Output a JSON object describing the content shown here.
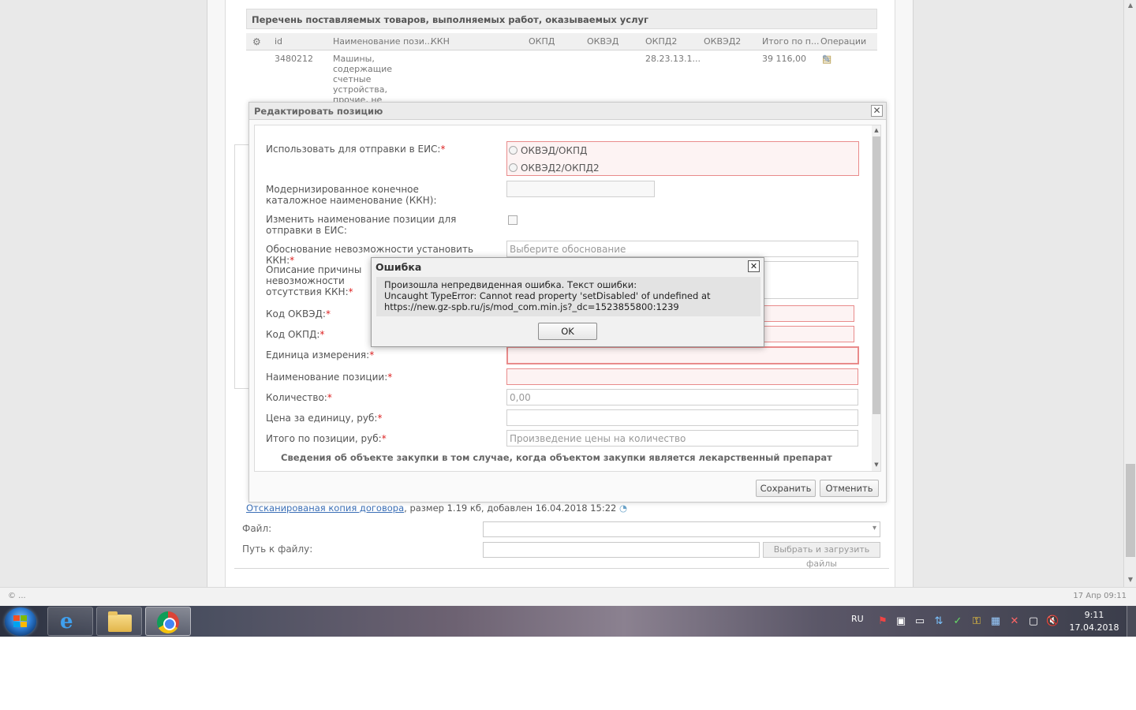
{
  "background": {
    "section_title": "Перечень поставляемых товаров, выполняемых работ, оказываемых услуг",
    "grid_headers": [
      "id",
      "Наименование пози...",
      "ККН",
      "ОКПД",
      "ОКВЭД",
      "ОКПД2",
      "ОКВЭД2",
      "Итого по п...",
      "Операции"
    ],
    "row": {
      "id": "3480212",
      "name": "Машины, содержащие счетные устройства, прочие, не включенные в другие группировки",
      "okpd2": "28.23.13.1...",
      "total": "39 116,00"
    },
    "file_link": "Отсканированая копия договора",
    "file_info": ", размер 1.19 кб, добавлен 16.04.2018 15:22",
    "file_label": "Файл:",
    "path_label": "Путь к файлу:",
    "upload_button": "Выбрать и загрузить файлы",
    "footer_left": "© ...",
    "footer_right": "17 Апр 09:11"
  },
  "edit_window": {
    "title": "Редактировать позицию",
    "fields": {
      "use_for_eis": "Использовать для отправки в ЕИС:",
      "radio_1": "ОКВЭД/ОКПД",
      "radio_2": "ОКВЭД2/ОКПД2",
      "kkn": "Модернизированное конечное каталожное наименование (ККН):",
      "change_name": "Изменить наименование позиции для отправки в ЕИС:",
      "kkn_reason": "Обоснование невозможности установить ККН:",
      "kkn_reason_placeholder": "Выберите обоснование",
      "kkn_description": "Описание причины невозможности отсутствия ККН:",
      "okved": "Код ОКВЭД:",
      "okpd": "Код ОКПД:",
      "unit": "Единица измерения:",
      "position_name": "Наименование позиции:",
      "quantity": "Количество:",
      "quantity_value": "0,00",
      "unit_price": "Цена за единицу, руб:",
      "position_total": "Итого по позиции, руб:",
      "position_total_placeholder": "Произведение цены на количество"
    },
    "drug_section": "Сведения об объекте закупки в том случае, когда объектом закупки является лекарственный препарат",
    "save_button": "Сохранить",
    "cancel_button": "Отменить"
  },
  "error_dialog": {
    "title": "Ошибка",
    "line1": "Произошла непредвиденная ошибка. Текст ошибки:",
    "line2": "Uncaught TypeError: Cannot read property 'setDisabled' of undefined at",
    "line3": "https://new.gz-spb.ru/js/mod_com.min.js?_dc=1523855800:1239",
    "ok_button": "OK"
  },
  "taskbar": {
    "language": "RU",
    "time": "9:11",
    "date": "17.04.2018",
    "apps": [
      "internet-explorer",
      "windows-explorer",
      "google-chrome"
    ]
  },
  "colors": {
    "invalid_border": "#e98b8b",
    "required_star": "#d22222",
    "link": "#3b6fb6"
  }
}
